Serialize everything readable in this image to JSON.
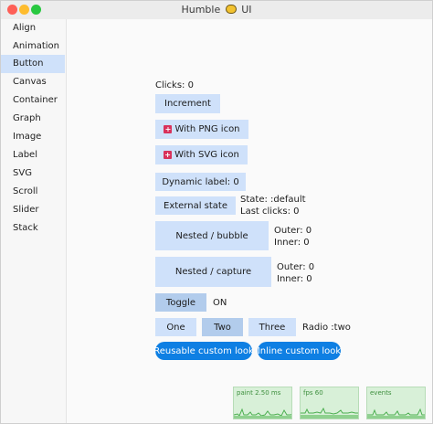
{
  "window": {
    "title_left": "Humble",
    "title_right": "UI",
    "title_icon": "bee-icon"
  },
  "sidebar": {
    "items": [
      {
        "label": "Align"
      },
      {
        "label": "Animation"
      },
      {
        "label": "Button",
        "selected": true
      },
      {
        "label": "Canvas"
      },
      {
        "label": "Container"
      },
      {
        "label": "Graph"
      },
      {
        "label": "Image"
      },
      {
        "label": "Label"
      },
      {
        "label": "SVG"
      },
      {
        "label": "Scroll"
      },
      {
        "label": "Slider"
      },
      {
        "label": "Stack"
      }
    ]
  },
  "main": {
    "clicks_label": "Clicks: 0",
    "increment": "Increment",
    "png_icon_button": "With PNG icon",
    "svg_icon_button": "With SVG icon",
    "dynamic_label": "Dynamic label: 0",
    "external_state": "External state",
    "state_text": "State: :default",
    "last_clicks": "Last clicks: 0",
    "nested_bubble": "Nested / bubble",
    "bubble_outer": "Outer: 0",
    "bubble_inner": "Inner: 0",
    "nested_capture": "Nested / capture",
    "capture_outer": "Outer: 0",
    "capture_inner": "Inner: 0",
    "toggle": "Toggle",
    "toggle_state": "ON",
    "radio_one": "One",
    "radio_two": "Two",
    "radio_three": "Three",
    "radio_value": "Radio :two",
    "reusable_custom": "Reusable custom look",
    "inline_custom": "Inline custom look"
  },
  "stats": {
    "paint": "paint 2.50 ms",
    "fps": "fps 60",
    "events": "events"
  },
  "colors": {
    "accent": "#0e7fe3",
    "button_bg": "#cfe1fa",
    "selected_bg": "#cfe1fa",
    "stat_bg": "#d8f0d8"
  }
}
